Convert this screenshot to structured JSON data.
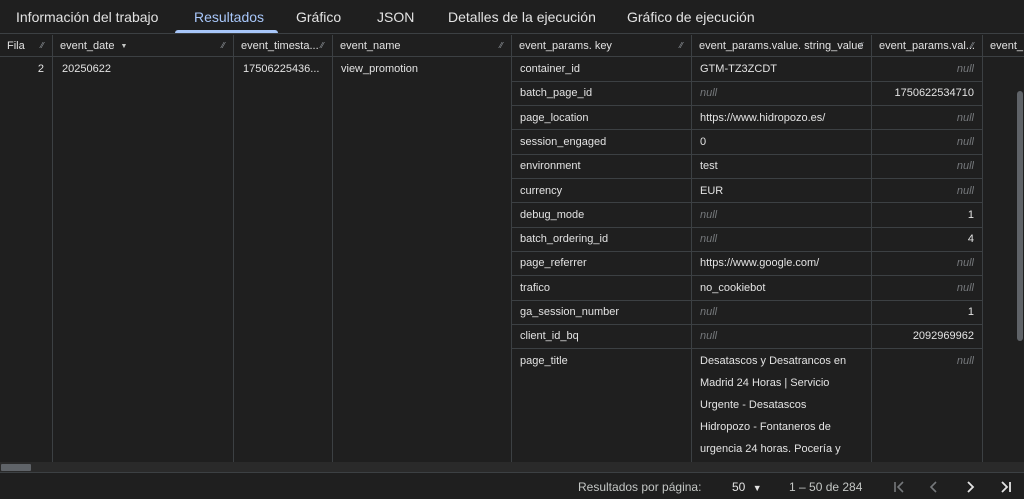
{
  "tabs": [
    {
      "label": "Información del trabajo"
    },
    {
      "label": "Resultados"
    },
    {
      "label": "Gráfico"
    },
    {
      "label": "JSON"
    },
    {
      "label": "Detalles de la ejecución"
    },
    {
      "label": "Gráfico de ejecución"
    }
  ],
  "columns": [
    "Fila",
    "event_date",
    "event_timesta...",
    "event_name",
    "event_params. key",
    "event_params.value. string_value",
    "event_params.val...",
    "event_"
  ],
  "row": {
    "fila": "2",
    "event_date": "20250622",
    "event_timestamp": "17506225436...",
    "event_name": "view_promotion"
  },
  "params": [
    {
      "key": "container_id",
      "string_value": "GTM-TZ3ZCDT",
      "int_value": "null"
    },
    {
      "key": "batch_page_id",
      "string_value": "null",
      "int_value": "1750622534710"
    },
    {
      "key": "page_location",
      "string_value": "https://www.hidropozo.es/",
      "int_value": "null"
    },
    {
      "key": "session_engaged",
      "string_value": "0",
      "int_value": "null"
    },
    {
      "key": "environment",
      "string_value": "test",
      "int_value": "null"
    },
    {
      "key": "currency",
      "string_value": "EUR",
      "int_value": "null"
    },
    {
      "key": "debug_mode",
      "string_value": "null",
      "int_value": "1"
    },
    {
      "key": "batch_ordering_id",
      "string_value": "null",
      "int_value": "4"
    },
    {
      "key": "page_referrer",
      "string_value": "https://www.google.com/",
      "int_value": "null"
    },
    {
      "key": "trafico",
      "string_value": "no_cookiebot",
      "int_value": "null"
    },
    {
      "key": "ga_session_number",
      "string_value": "null",
      "int_value": "1"
    },
    {
      "key": "client_id_bq",
      "string_value": "null",
      "int_value": "2092969962"
    },
    {
      "key": "page_title",
      "string_value": "Desatascos y Desatrancos en Madrid 24 Horas | Servicio Urgente - Desatascos Hidropozo - Fontaneros de urgencia 24 horas. Pocería y",
      "int_value": "null"
    }
  ],
  "footer": {
    "per_page_label": "Resultados por página:",
    "per_page_value": "50",
    "range": "1 – 50 de 284"
  },
  "colors": {
    "background": "#1f1f1f",
    "accent": "#a8c7fa",
    "grid_line": "#3c4043",
    "null_text": "#75787b"
  },
  "icons": [
    "sort-arrow-icon",
    "column-resize-icon",
    "dropdown-caret-icon",
    "first-page-icon",
    "previous-page-icon",
    "next-page-icon",
    "last-page-icon"
  ]
}
